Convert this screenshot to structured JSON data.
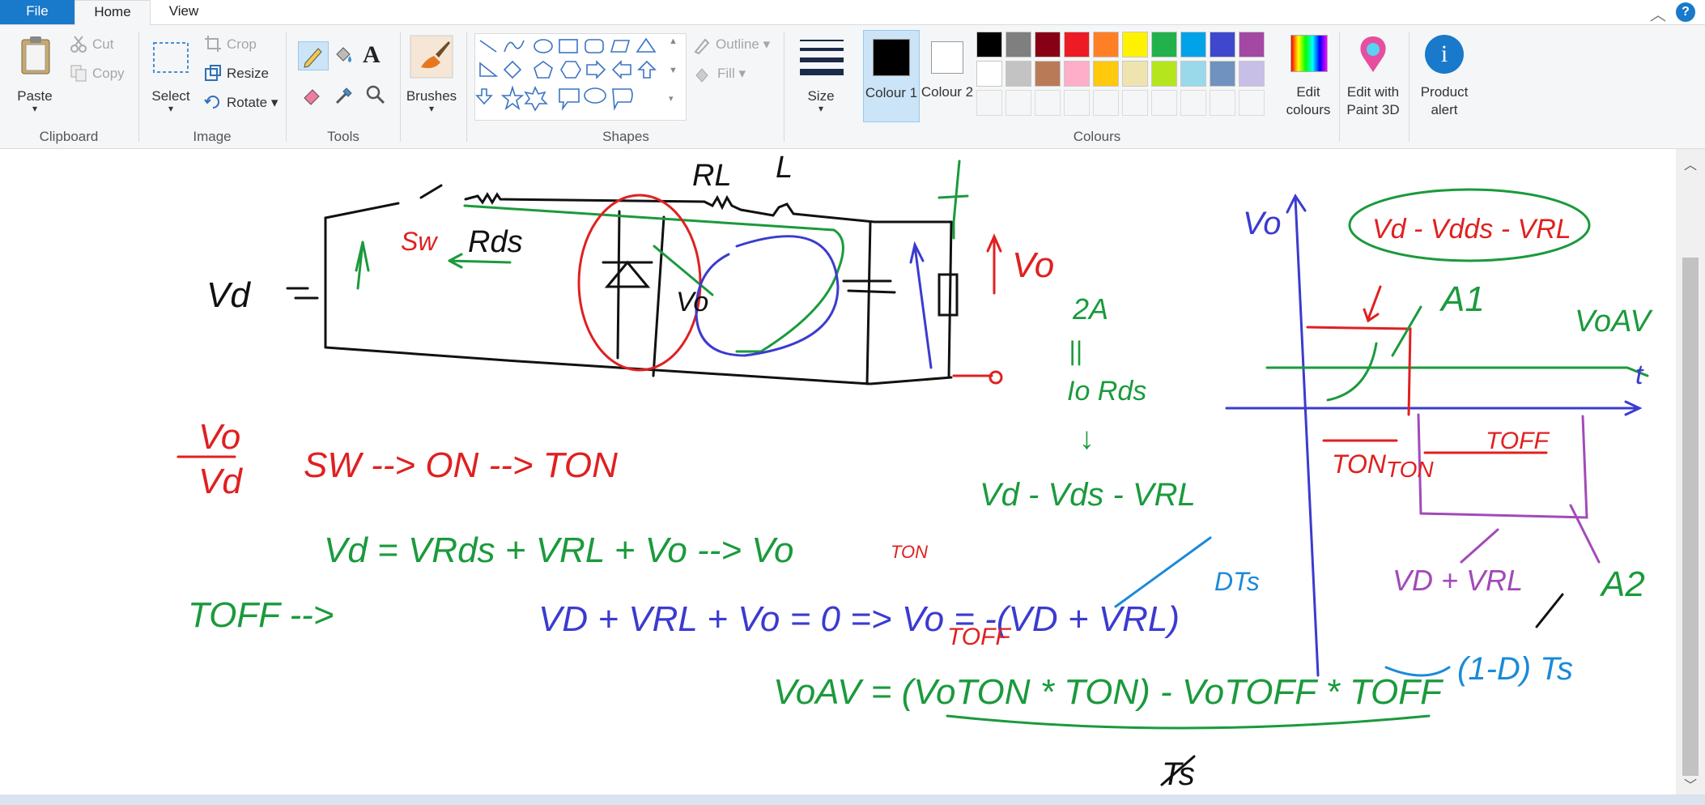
{
  "tabs": {
    "file": "File",
    "home": "Home",
    "view": "View"
  },
  "window": {
    "help": "?"
  },
  "clipboard": {
    "paste": "Paste",
    "cut": "Cut",
    "copy": "Copy",
    "group": "Clipboard"
  },
  "image": {
    "select": "Select",
    "crop": "Crop",
    "resize": "Resize",
    "rotate": "Rotate",
    "group": "Image"
  },
  "tools": {
    "group": "Tools"
  },
  "brushes": {
    "label": "Brushes"
  },
  "shapes": {
    "outline": "Outline",
    "fill": "Fill",
    "group": "Shapes"
  },
  "size": {
    "label": "Size"
  },
  "colours": {
    "colour1": "Colour 1",
    "colour2": "Colour 2",
    "edit": "Edit colours",
    "edit_paint3d": "Edit with Paint 3D",
    "product_alert": "Product alert",
    "group": "Colours",
    "palette_row1": [
      "#000000",
      "#7f7f7f",
      "#880015",
      "#ed1c24",
      "#ff7f27",
      "#fff200",
      "#22b14c",
      "#00a2e8",
      "#3f48cc",
      "#a349a4"
    ],
    "palette_row2": [
      "#ffffff",
      "#c3c3c3",
      "#b97a57",
      "#ffaec9",
      "#ffc90e",
      "#efe4b0",
      "#b5e61d",
      "#99d9ea",
      "#7092be",
      "#c8bfe7"
    ]
  },
  "drawing": {
    "vd": "Vd",
    "sw": "Sw",
    "rds": "Rds",
    "rl": "RL",
    "l": "L",
    "vo_diode": "Vo",
    "vo_out": "Vo",
    "ratio_num": "Vo",
    "ratio_den": "Vd",
    "sw_on": "SW --> ON --> TON",
    "eq1": "Vd = VRds + VRL + Vo --> Vo",
    "eq1_sub": "TON",
    "toff": "TOFF -->",
    "eq2": "VD + VRL + Vo = 0 => Vo = -(VD + VRL)",
    "eq2_sub": "TOFF",
    "dts": "DTs",
    "current": "2A",
    "parallel": "||",
    "io_rds": "Io Rds",
    "down_arrow": "↓",
    "eq_vd": "Vd - Vds - VRL",
    "voav_eq": "VoAV = (VoTON * TON) - VoTOFF * TOFF",
    "one_minus_d": "(1-D) Ts",
    "ts": "Ts",
    "graph_vo": "Vo",
    "graph_box": "Vd - Vdds - VRL",
    "a1": "A1",
    "voav": "VoAV",
    "t": "t",
    "ton": "TON",
    "ton2": "TON",
    "toff_g": "TOFF",
    "vd_vrl": "VD + VRL",
    "a2": "A2"
  }
}
